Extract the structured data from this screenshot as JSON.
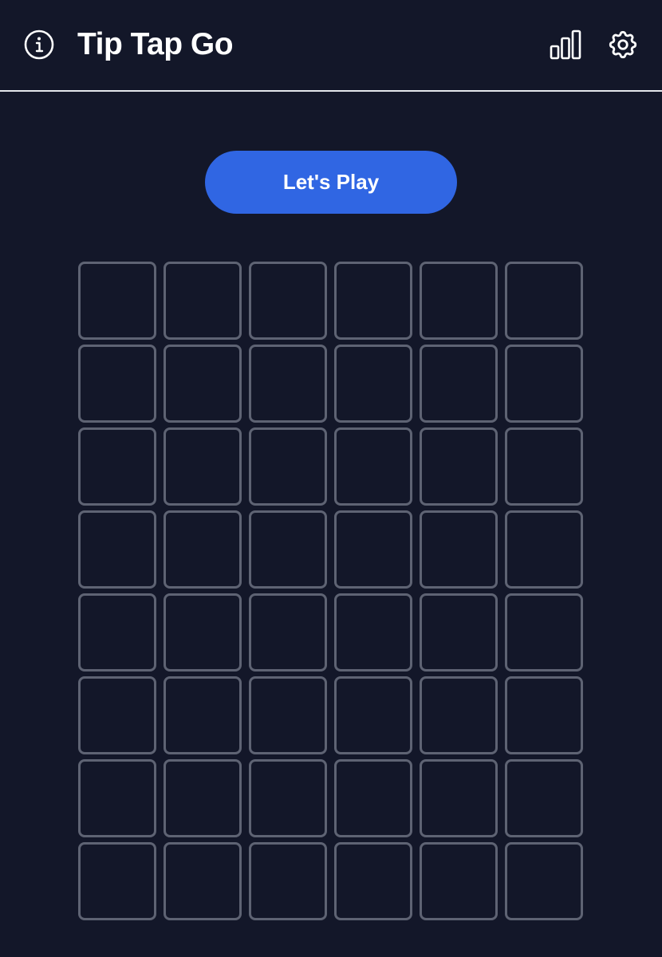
{
  "header": {
    "title": "Tip Tap Go",
    "icons": {
      "info": "info-circle-icon",
      "stats": "bar-chart-icon",
      "settings": "gear-icon"
    }
  },
  "actions": {
    "play_label": "Let's Play"
  },
  "board": {
    "columns": 6,
    "rows": 8,
    "cells": [
      "",
      "",
      "",
      "",
      "",
      "",
      "",
      "",
      "",
      "",
      "",
      "",
      "",
      "",
      "",
      "",
      "",
      "",
      "",
      "",
      "",
      "",
      "",
      "",
      "",
      "",
      "",
      "",
      "",
      "",
      "",
      "",
      "",
      "",
      "",
      "",
      "",
      "",
      "",
      "",
      "",
      "",
      "",
      "",
      "",
      "",
      "",
      ""
    ]
  },
  "colors": {
    "background": "#131729",
    "accent": "#3066e3",
    "cell_border": "#5e6373",
    "text": "#ffffff"
  }
}
